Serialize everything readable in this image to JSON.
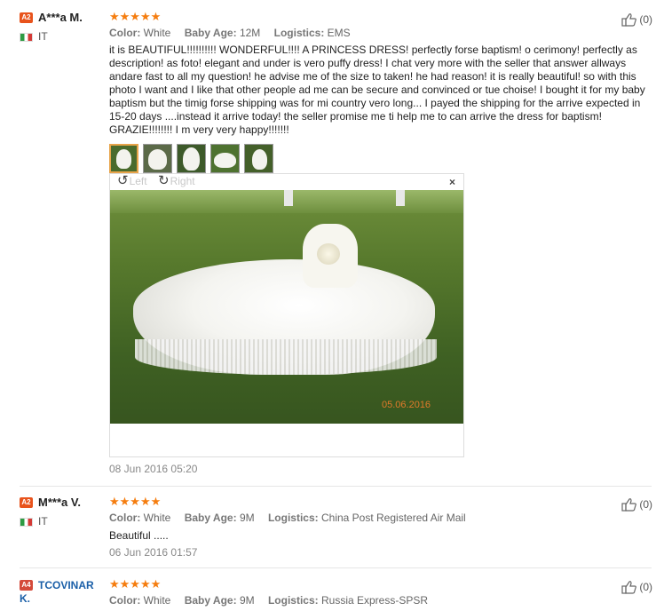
{
  "labels": {
    "color": "Color:",
    "baby_age": "Baby Age:",
    "logistics": "Logistics:"
  },
  "reviews": [
    {
      "badge": "A2",
      "name": "A***a M.",
      "country": "IT",
      "stars": "★★★★★",
      "rating": 5,
      "color": "White",
      "baby_age": "12M",
      "logistics": "EMS",
      "helpful_count": "(0)",
      "text": "it is BEAUTIFUL!!!!!!!!!! WONDERFUL!!!! A PRINCESS DRESS! perfectly forse baptism! o cerimony! perfectly as description! as foto! elegant and under is vero puffy dress! I chat very more with the seller that answer allways andare fast to all my question! he advise me of the size to taken! he had reason! it is really beautiful! so with this photo I want and I like that other people ad me can be secure and convinced or tue choise! I bought it for my baby baptism but the timig forse shipping was for mi country vero long... I payed the shipping for the arrive expected in 15-20 days ....instead it arrive today! the seller promise me ti help me to can arrive the dress for baptism! GRAZIE!!!!!!!! I m very very happy!!!!!!!",
      "viewer": {
        "rotate_left": "Left",
        "rotate_right": "Right",
        "close": "×",
        "photo_stamp": "05.06.2016"
      },
      "date": "08 Jun 2016 05:20"
    },
    {
      "badge": "A2",
      "name": "M***a V.",
      "country": "IT",
      "stars": "★★★★★",
      "rating": 5,
      "color": "White",
      "baby_age": "9M",
      "logistics": "China Post Registered Air Mail",
      "helpful_count": "(0)",
      "text": "Beautiful .....",
      "date": "06 Jun 2016 01:57"
    },
    {
      "badge": "A4",
      "name": "TCOVINAR",
      "name_line2": "K.",
      "stars": "★★★★★",
      "rating": 5,
      "color": "White",
      "baby_age": "9M",
      "logistics": "Russia Express-SPSR",
      "helpful_count": "(0)"
    }
  ],
  "colors": {
    "star": "#f57d0f",
    "badge_a2": "#e8531c",
    "badge_a4": "#d44a3a",
    "name_blue": "#1a5fa8"
  }
}
